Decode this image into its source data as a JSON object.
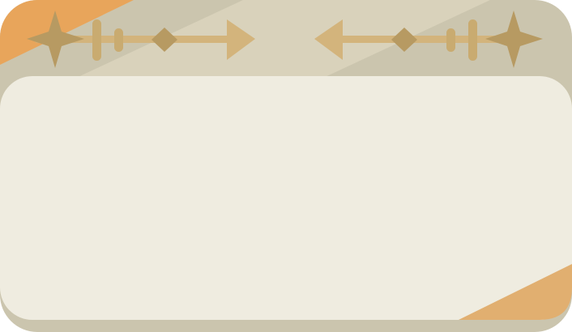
{
  "banner": {
    "kind": "decorative-card-frame",
    "colors": {
      "frame": "#cbc5ae",
      "stripe": "#d9d2bb",
      "panel": "#efece0",
      "accent_orange": "#e8a55b",
      "accent_peach": "#e1af70",
      "arrow": "#d3b47c",
      "star": "#b79a62"
    },
    "icons": {
      "left_star": "compass-star-icon",
      "left_arrow": "right-arrow-icon",
      "right_star": "compass-star-icon",
      "right_arrow": "left-arrow-icon"
    }
  }
}
